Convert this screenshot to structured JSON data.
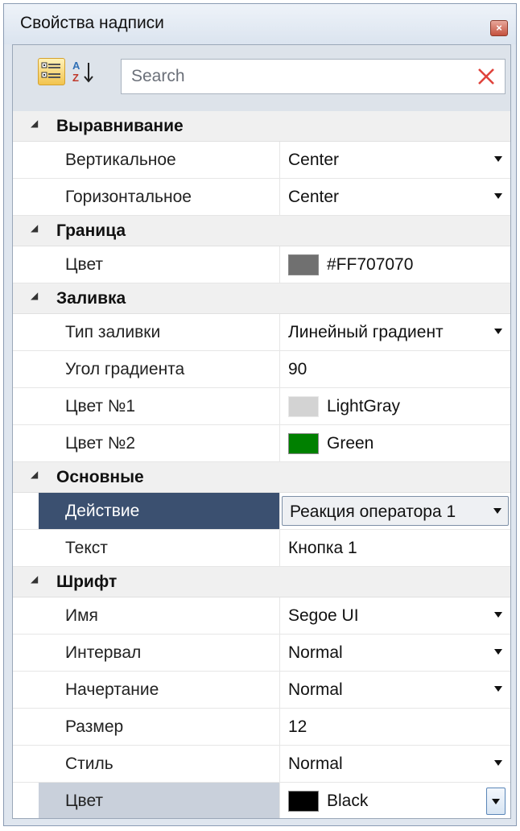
{
  "window": {
    "title": "Свойства надписи"
  },
  "toolbar": {
    "search_placeholder": "Search",
    "sort_label": "A Z"
  },
  "categories": {
    "alignment": {
      "label": "Выравнивание",
      "vertical": {
        "name": "Вертикальное",
        "value": "Center"
      },
      "horizontal": {
        "name": "Горизонтальное",
        "value": "Center"
      }
    },
    "border": {
      "label": "Граница",
      "color": {
        "name": "Цвет",
        "value": "#FF707070",
        "swatch": "#707070"
      }
    },
    "fill": {
      "label": "Заливка",
      "type": {
        "name": "Тип заливки",
        "value": "Линейный градиент"
      },
      "angle": {
        "name": "Угол градиента",
        "value": "90"
      },
      "color1": {
        "name": "Цвет №1",
        "value": "LightGray",
        "swatch": "#d3d3d3"
      },
      "color2": {
        "name": "Цвет №2",
        "value": "Green",
        "swatch": "#008000"
      }
    },
    "main": {
      "label": "Основные",
      "action": {
        "name": "Действие",
        "value": "Реакция оператора 1"
      },
      "text": {
        "name": "Текст",
        "value": "Кнопка 1"
      }
    },
    "font": {
      "label": "Шрифт",
      "family": {
        "name": "Имя",
        "value": "Segoe UI"
      },
      "spacing": {
        "name": "Интервал",
        "value": "Normal"
      },
      "weight": {
        "name": "Начертание",
        "value": "Normal"
      },
      "size": {
        "name": "Размер",
        "value": "12"
      },
      "style": {
        "name": "Стиль",
        "value": "Normal"
      },
      "color": {
        "name": "Цвет",
        "value": "Black",
        "swatch": "#000000"
      }
    }
  },
  "colors": {
    "selection": "#3b5070",
    "accent_close": "#c4513e"
  }
}
